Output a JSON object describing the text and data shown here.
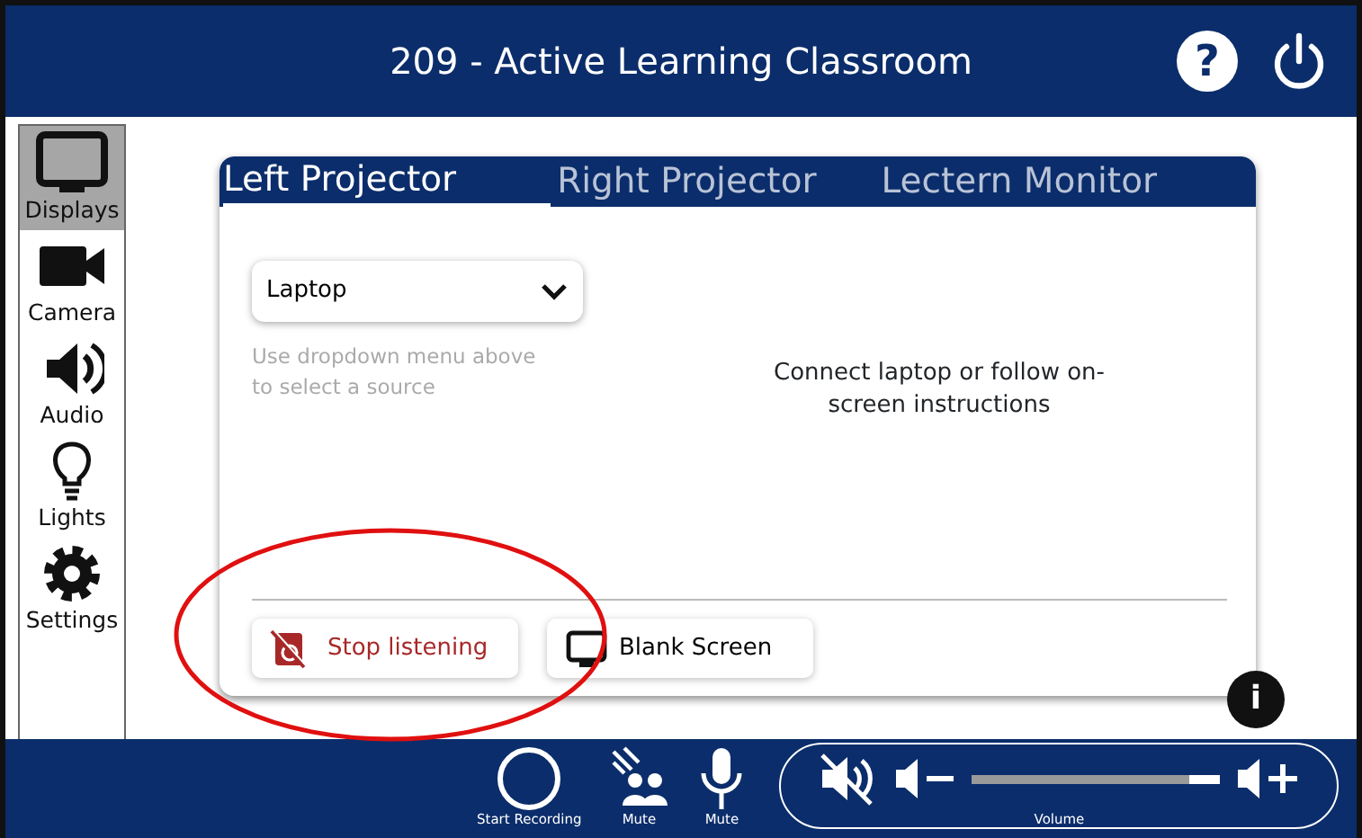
{
  "header": {
    "title": "209 - Active Learning Classroom",
    "help": "?"
  },
  "sidebar": {
    "items": [
      {
        "kind": "displays",
        "label": "Displays",
        "selected": true
      },
      {
        "kind": "camera",
        "label": "Camera",
        "selected": false
      },
      {
        "kind": "audio",
        "label": "Audio",
        "selected": false
      },
      {
        "kind": "lights",
        "label": "Lights",
        "selected": false
      },
      {
        "kind": "settings",
        "label": "Settings",
        "selected": false
      }
    ]
  },
  "tabs": [
    {
      "label": "Left Projector",
      "selected": true
    },
    {
      "label": "Right Projector",
      "selected": false
    },
    {
      "label": "Lectern Monitor",
      "selected": false
    }
  ],
  "source_select": {
    "value": "Laptop",
    "hint": "Use dropdown menu above to select a source"
  },
  "message": "Connect laptop or follow on-screen instructions",
  "actions": [
    {
      "kind": "stop-listening",
      "label": "Stop listening"
    },
    {
      "kind": "blank-screen",
      "label": "Blank Screen"
    }
  ],
  "info": "i",
  "bottom_bar": {
    "controls": [
      {
        "kind": "record",
        "label": "Start Recording"
      },
      {
        "kind": "mute-room",
        "label": "Mute"
      },
      {
        "kind": "mute-mic",
        "label": "Mute"
      }
    ],
    "volume": {
      "label": "Volume",
      "level": 0.88
    }
  },
  "annotation": {
    "kind": "ellipse",
    "color": "#e01010"
  }
}
